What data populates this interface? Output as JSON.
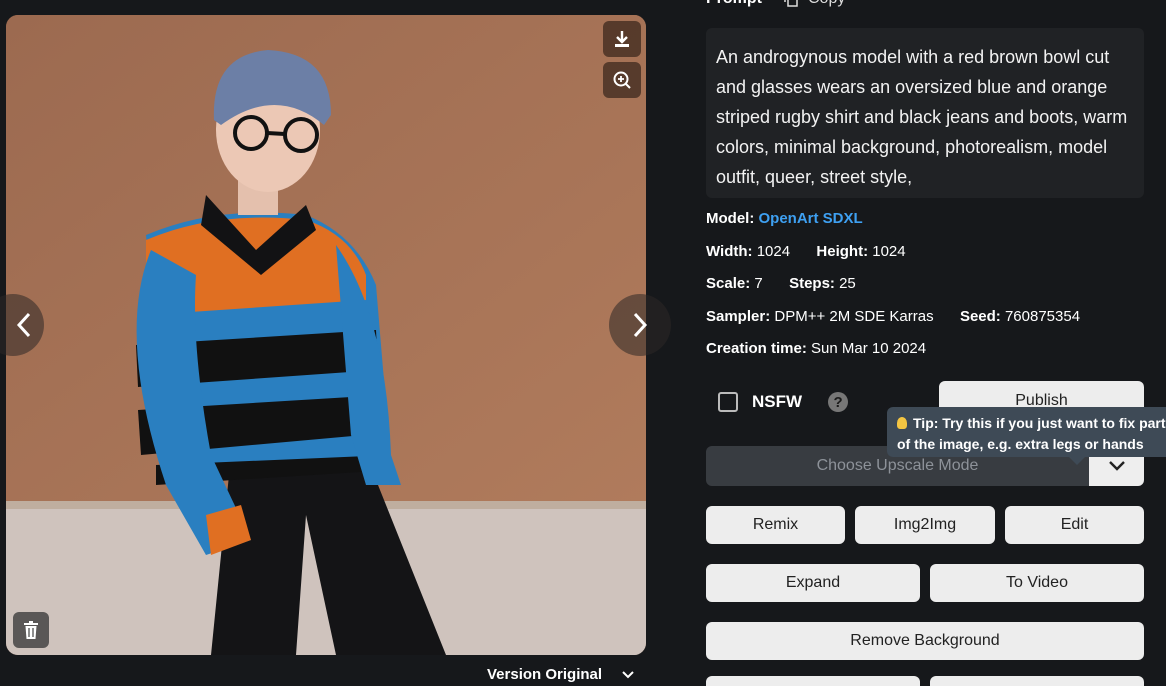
{
  "image": {
    "download_label": "download",
    "zoom_label": "zoom",
    "version_label": "Version Original"
  },
  "prompt": {
    "heading": "Prompt",
    "copy_label": "Copy",
    "text": "An androgynous model with a red brown bowl cut and glasses wears an oversized blue and orange striped rugby shirt and black jeans and boots, warm colors, minimal background, photorealism, model outfit, queer, street style,"
  },
  "meta": {
    "model_label": "Model:",
    "model_value": "OpenArt SDXL",
    "width_label": "Width:",
    "width_value": "1024",
    "height_label": "Height:",
    "height_value": "1024",
    "scale_label": "Scale:",
    "scale_value": "7",
    "steps_label": "Steps:",
    "steps_value": "25",
    "sampler_label": "Sampler:",
    "sampler_value": "DPM++ 2M SDE Karras",
    "seed_label": "Seed:",
    "seed_value": "760875354",
    "creation_label": "Creation time:",
    "creation_value": "Sun Mar 10 2024"
  },
  "nsfw": {
    "label": "NSFW",
    "help": "?"
  },
  "actions": {
    "publish": "Publish",
    "upscale_placeholder": "Choose Upscale Mode",
    "remix": "Remix",
    "img2img": "Img2Img",
    "edit": "Edit",
    "expand": "Expand",
    "to_video": "To Video",
    "remove_background": "Remove Background"
  },
  "tooltip": {
    "line1": "Tip: Try this if you just want to fix parts",
    "line2": "of the image, e.g. extra legs or hands"
  },
  "colors": {
    "bg": "#16181b",
    "link": "#3ea0f2",
    "button": "#ededed",
    "tooltip": "#3e4a56"
  }
}
